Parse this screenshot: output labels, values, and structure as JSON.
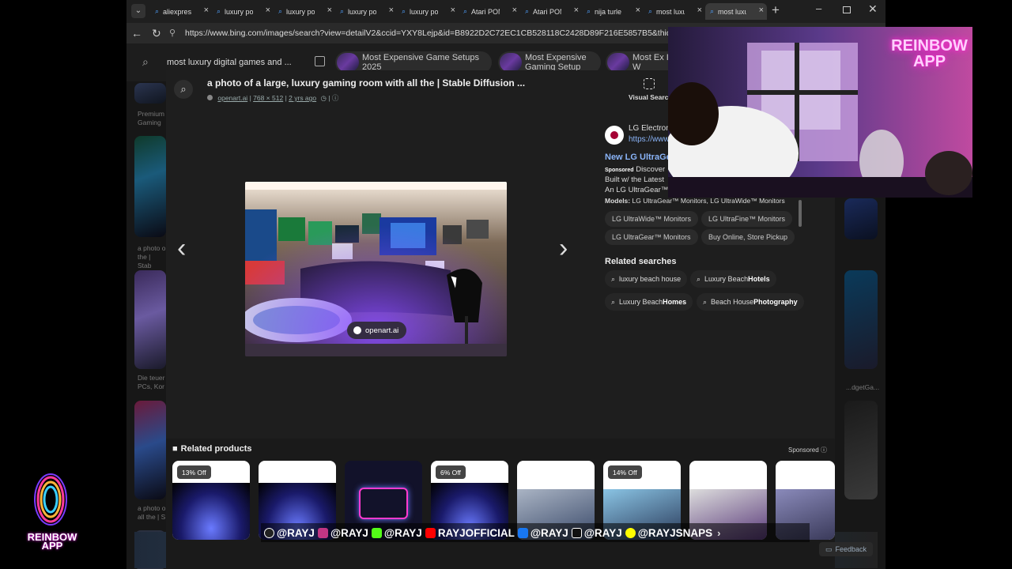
{
  "browser": {
    "tabs": [
      {
        "label": "aliexpress"
      },
      {
        "label": "luxury por"
      },
      {
        "label": "luxury por"
      },
      {
        "label": "luxury por"
      },
      {
        "label": "luxury por"
      },
      {
        "label": "Atari PON"
      },
      {
        "label": "Atari PON"
      },
      {
        "label": "nija turle a"
      },
      {
        "label": "most luxu"
      },
      {
        "label": "most luxu"
      }
    ],
    "new_tab": "+",
    "url": "https://www.bing.com/images/search?view=detailV2&ccid=YXY8Lejp&id=B8922D2C72EC1CB528118C2428D89F216E5857B5&thid=OIP.YXY8"
  },
  "search": {
    "query": "most luxury digital games and ...",
    "chips": [
      {
        "label": "Most Expensive Game Setups 2025"
      },
      {
        "label": "Most Expensive Gaming Setup"
      },
      {
        "label": "Most Ex In The W"
      }
    ]
  },
  "side_captions": [
    "Premium Gaming",
    "a photo o the | Stab",
    "Die teuer PCs, Kor",
    "a photo o all the | S"
  ],
  "right_side_captions": [
    "...dgetGa..."
  ],
  "overlay": {
    "title": "a photo of a large, luxury gaming room with all the | Stable Diffusion ...",
    "source": "openart.ai",
    "dimensions": "768 × 512",
    "age": "2 yrs ago",
    "visual_search": "Visual Search",
    "image_badge": "openart.ai"
  },
  "ad": {
    "advertiser": "LG Electron",
    "url": "https://www.",
    "headline": "New LG UltraGe",
    "sponsored": "Sponsored",
    "desc_line1": "Discover",
    "desc_line2": "Built w/ the Latest",
    "desc_line3": "An LG UltraGear™",
    "models_label": "Models:",
    "models": "LG UltraGear™ Monitors, LG UltraWide™ Monitors",
    "pills": [
      "LG UltraWide™ Monitors",
      "LG UltraFine™ Monitors",
      "LG UltraGear™ Monitors",
      "Buy Online, Store Pickup"
    ]
  },
  "related_searches": {
    "title": "Related searches",
    "items": [
      {
        "normal": "luxury beach house",
        "bold": ""
      },
      {
        "normal": "Luxury Beach ",
        "bold": "Hotels"
      },
      {
        "normal": "Luxury Beach ",
        "bold": "Homes"
      },
      {
        "normal": "Beach House ",
        "bold": "Photography"
      }
    ]
  },
  "related_products": {
    "title": "Related products",
    "sponsored": "Sponsored",
    "items": [
      {
        "discount": "13% Off"
      },
      {
        "discount": ""
      },
      {
        "discount": ""
      },
      {
        "discount": "6% Off"
      },
      {
        "discount": ""
      },
      {
        "discount": "14% Off"
      },
      {
        "discount": ""
      },
      {
        "discount": ""
      }
    ]
  },
  "stream": {
    "logo_text": "REINBOW APP",
    "neon_sign": "REINBOW APP",
    "socials": [
      {
        "handle": "@RAYJ",
        "color": "#222222"
      },
      {
        "handle": "@RAYJ",
        "color": "#c13584"
      },
      {
        "handle": "@RAYJ",
        "color": "#53fc18"
      },
      {
        "handle": "RAYJOFFICIAL",
        "color": "#ff0000"
      },
      {
        "handle": "@RAYJ",
        "color": "#1877f2"
      },
      {
        "handle": "@RAYJ",
        "color": "#111111"
      },
      {
        "handle": "@RAYJSNAPS",
        "color": "#fffc00"
      }
    ]
  },
  "feedback": "Feedback"
}
